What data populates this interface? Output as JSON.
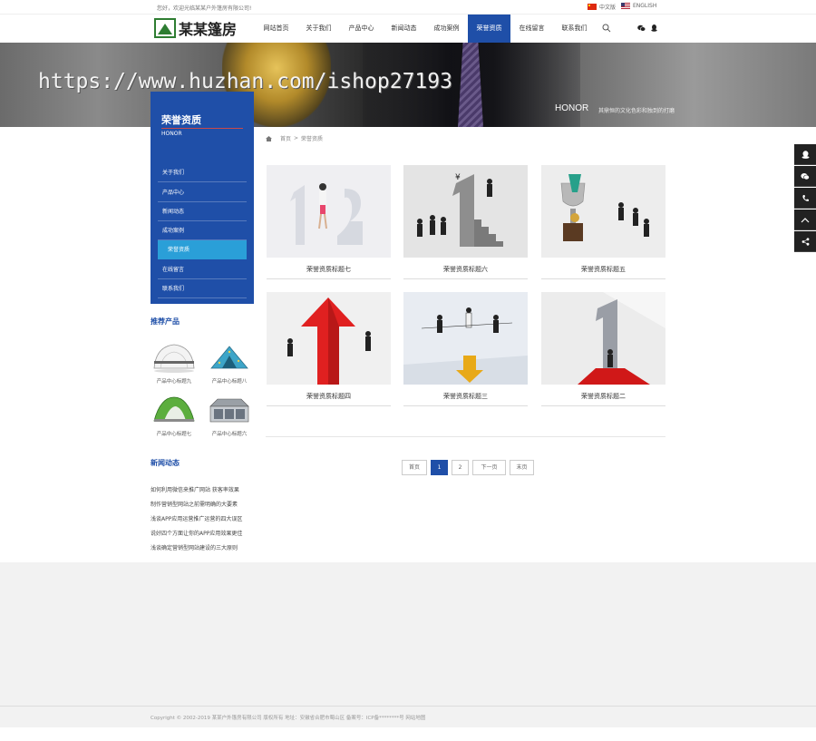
{
  "topbar": {
    "welcome": "您好，欢迎光临某某户外篷房有限公司!",
    "lang_cn": "中文版",
    "lang_en": "ENGLISH"
  },
  "header": {
    "logo_text": "某某篷房",
    "nav": [
      "网站首页",
      "关于我们",
      "产品中心",
      "新闻动态",
      "成功案例",
      "荣誉资质",
      "在线留言",
      "联系我们"
    ],
    "active_index": 5
  },
  "banner": {
    "watermark": "https://www.huzhan.com/ishop27193",
    "title_en": "HONOR",
    "subtitle_cn": "其鼎恒的文化色彩和独到的打磨"
  },
  "sidebar": {
    "title": "荣誉资质",
    "title_en": "HONOR",
    "menu": [
      "关于我们",
      "产品中心",
      "新闻动态",
      "成功案例",
      "荣誉资质",
      "在线留言",
      "联系我们"
    ],
    "active_index": 4,
    "products_title": "推荐产品",
    "products": [
      "产品中心标题九",
      "产品中心标题八",
      "产品中心标题七",
      "产品中心标题六"
    ],
    "news_title": "新闻动态",
    "news": [
      "如何利用微信来推广网站 获客率效果",
      "制作营销型网站之前需明确的大要素",
      "浅谈APP应用运营推广运营的四大误区",
      "说好四个方面让你的APP应用效果更佳",
      "浅谈确定营销型网站建设的三大原则"
    ]
  },
  "breadcrumb": {
    "home": "首页",
    "sep": ">",
    "current": "荣誉资质"
  },
  "cards": [
    {
      "title": "荣誉资质标题七",
      "color": "#e9e9ec"
    },
    {
      "title": "荣誉资质标题六",
      "color": "#dedede"
    },
    {
      "title": "荣誉资质标题五",
      "color": "#ececec"
    },
    {
      "title": "荣誉资质标题四",
      "color": "#f0f0f0"
    },
    {
      "title": "荣誉资质标题三",
      "color": "#e6eaf0"
    },
    {
      "title": "荣誉资质标题二",
      "color": "#e8e8e8"
    }
  ],
  "pager": {
    "first": "首页",
    "pages": [
      "1",
      "2"
    ],
    "active_index": 0,
    "next": "下一页",
    "last": "末页"
  },
  "footer": {
    "text": "Copyright © 2002-2019 某某户外篷房有限公司 版权所有    地址：安徽省合肥市蜀山区    备案号：ICP备********号    网站地图"
  },
  "colors": {
    "primary": "#1f4fa8",
    "highlight": "#2a9fd8",
    "float_bar": "#222222"
  }
}
